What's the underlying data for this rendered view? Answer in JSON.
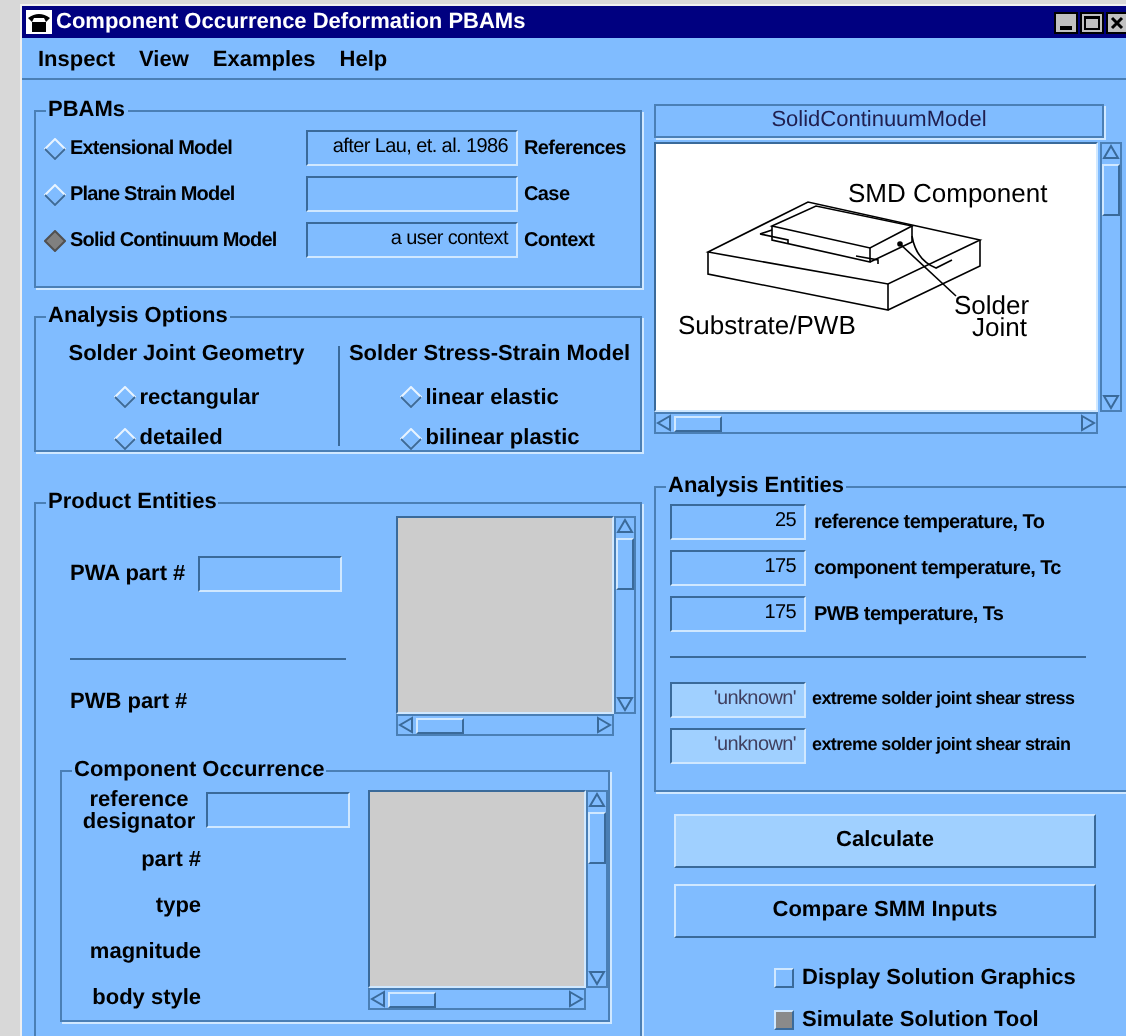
{
  "window": {
    "title": "Component Occurrence Deformation PBAMs"
  },
  "menu": [
    "Inspect",
    "View",
    "Examples",
    "Help"
  ],
  "pbams": {
    "title": "PBAMs",
    "models": [
      {
        "label": "Extensional Model",
        "selected": false,
        "value": "after Lau, et. al. 1986",
        "field_label": "References"
      },
      {
        "label": "Plane Strain Model",
        "selected": false,
        "field_label": "Case"
      },
      {
        "label": "Solid Continuum Model",
        "selected": true,
        "value": "a user context",
        "field_label": "Context"
      }
    ]
  },
  "analysis_options": {
    "title": "Analysis Options",
    "groups": [
      {
        "title": "Solder Joint Geometry",
        "options": [
          {
            "label": "rectangular",
            "selected": false
          },
          {
            "label": "detailed",
            "selected": false
          }
        ]
      },
      {
        "title": "Solder Stress-Strain Model",
        "options": [
          {
            "label": "linear elastic",
            "selected": false
          },
          {
            "label": "bilinear plastic",
            "selected": false
          }
        ]
      }
    ]
  },
  "preview": {
    "title": "SolidContinuumModel",
    "labels": [
      {
        "lines": [
          "SMD Component"
        ]
      },
      {
        "lines": [
          "Substrate/PWB"
        ]
      },
      {
        "lines": [
          "Solder",
          "Joint"
        ]
      }
    ]
  },
  "product_entities": {
    "title": "Product Entities",
    "pwa_label": "PWA part #",
    "pwb_label": "PWB part #",
    "component_occurrence": {
      "title": "Component Occurrence",
      "fields": [
        {
          "label": "reference designator",
          "kind": "input"
        },
        {
          "label": "part #",
          "kind": "text"
        },
        {
          "label": "type",
          "kind": "text"
        },
        {
          "label": "magnitude",
          "kind": "text"
        },
        {
          "label": "body style",
          "kind": "text"
        }
      ]
    }
  },
  "analysis_entities": {
    "title": "Analysis Entities",
    "inputs": [
      {
        "value": "25",
        "label": "reference temperature, To"
      },
      {
        "value": "175",
        "label": "component temperature, Tc"
      },
      {
        "value": "175",
        "label": "PWB temperature, Ts"
      }
    ],
    "results": [
      {
        "value": "'unknown'",
        "label": "extreme solder joint shear stress"
      },
      {
        "value": "'unknown'",
        "label": "extreme solder joint shear strain"
      }
    ]
  },
  "buttons": [
    {
      "label": "Calculate",
      "focused": true
    },
    {
      "label": "Compare SMM Inputs",
      "focused": false
    }
  ],
  "checkboxes": [
    {
      "label": "Display Solution Graphics",
      "checked": false
    },
    {
      "label": "Simulate Solution Tool",
      "checked": true
    }
  ]
}
